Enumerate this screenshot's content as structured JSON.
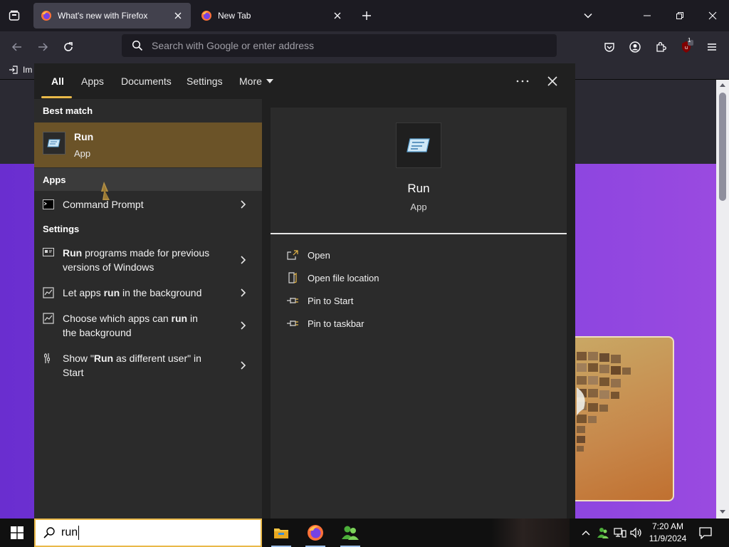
{
  "browser": {
    "tabs": [
      {
        "title": "What's new with Firefox",
        "active": true
      },
      {
        "title": "New Tab",
        "active": false
      }
    ],
    "url_placeholder": "Search with Google or enter address",
    "extensions_badge": "1",
    "bookmarks": [
      {
        "label": "Im"
      }
    ]
  },
  "search_panel": {
    "tabs": [
      "All",
      "Apps",
      "Documents",
      "Settings",
      "More"
    ],
    "active_tab": "All",
    "sections": {
      "best_match": "Best match",
      "apps": "Apps",
      "settings": "Settings"
    },
    "best_match": {
      "name": "Run",
      "type": "App"
    },
    "apps": [
      {
        "label": "Command Prompt"
      }
    ],
    "settings": [
      {
        "line1_bold": "Run",
        "line1_rest": " programs made for previous",
        "line2": "versions of Windows"
      },
      {
        "line1_pre": "Let apps ",
        "line1_bold": "run",
        "line1_rest": " in the background"
      },
      {
        "line1_pre": "Choose which apps can ",
        "line1_bold": "run",
        "line1_rest": " in",
        "line2": "the background"
      },
      {
        "line1_pre": "Show \"",
        "line1_bold": "Run",
        "line1_rest": " as different user\" in",
        "line2": "Start"
      }
    ],
    "detail": {
      "name": "Run",
      "type": "App",
      "actions": [
        "Open",
        "Open file location",
        "Pin to Start",
        "Pin to taskbar"
      ]
    }
  },
  "taskbar": {
    "search_value": "run",
    "apps": [
      "File Explorer",
      "Firefox",
      "People"
    ],
    "time": "7:20 AM",
    "date": "11/9/2024"
  },
  "colors": {
    "accent": "#e9b949",
    "best_match_bg": "#6b5328",
    "panel_bg": "#2b2b2b",
    "page_purple": "#7a3ee0"
  }
}
